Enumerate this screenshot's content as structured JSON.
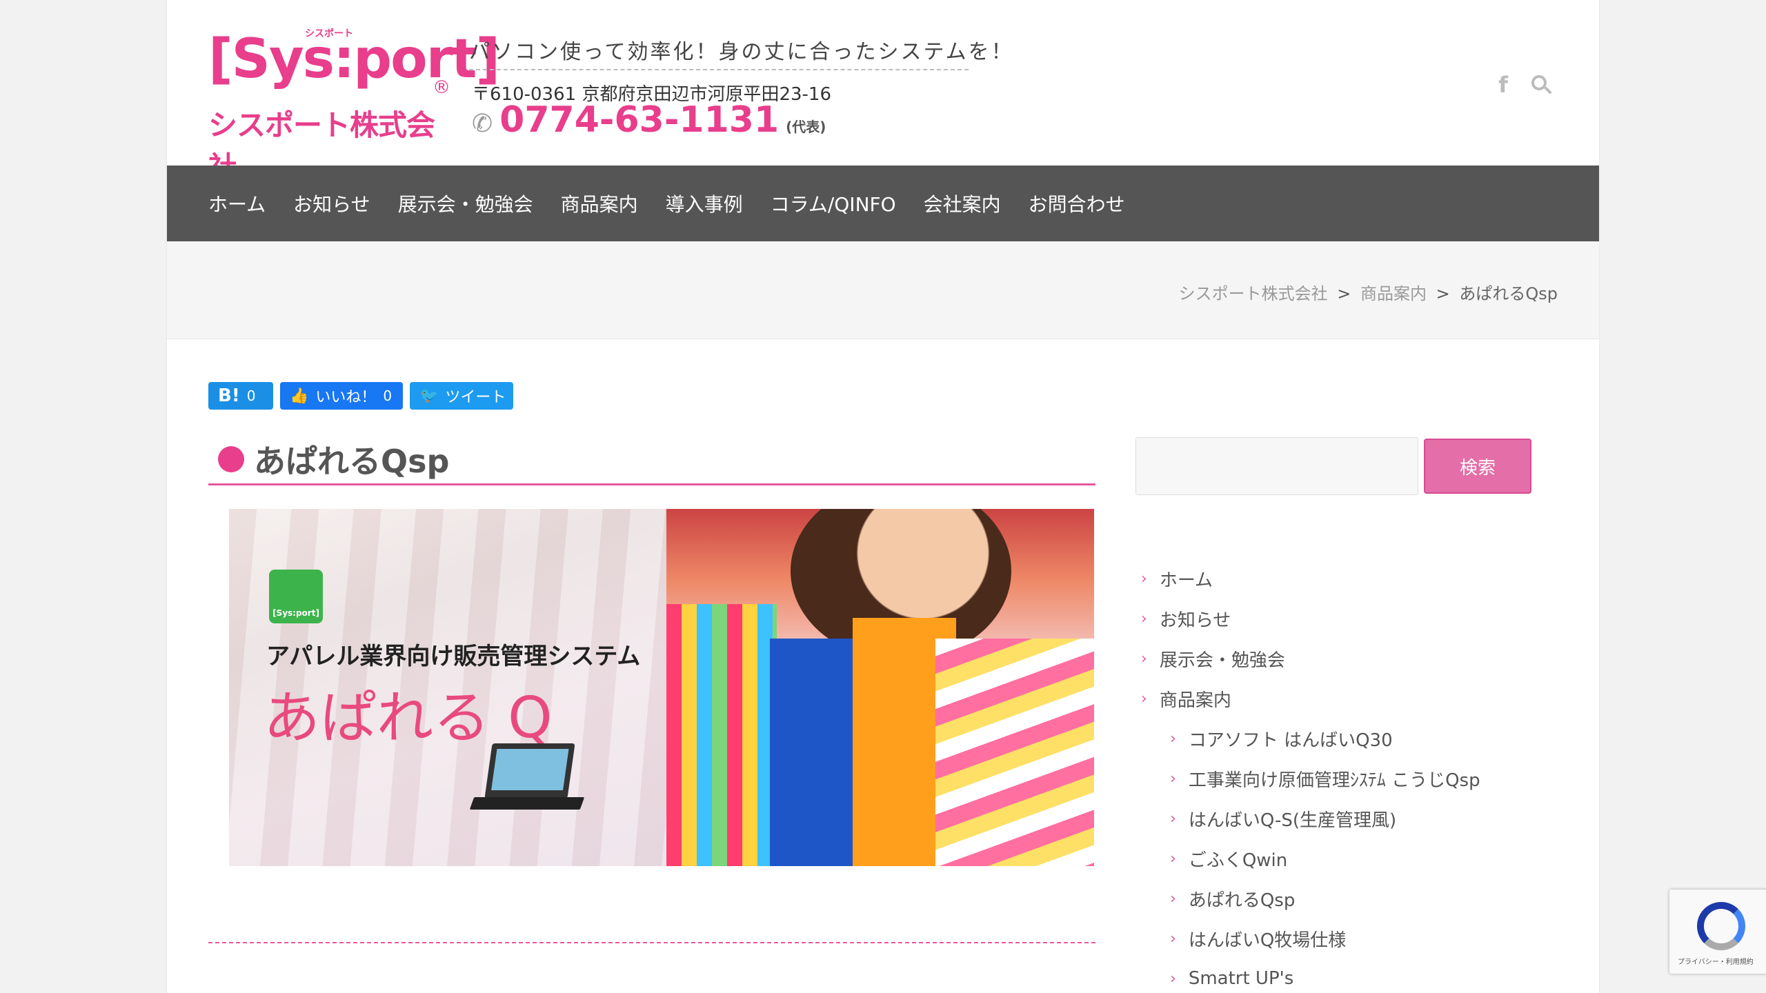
{
  "header": {
    "logo_kana": "シスポート",
    "logo_main": "[Sys:port]",
    "logo_reg": "®",
    "logo_sub": "シスポート株式会社",
    "catch": "パソコン使って効率化！身の丈に合ったシステムを！",
    "address": "〒610-0361 京都府京田辺市河原平田23-16",
    "phone": "0774-63-1131",
    "phone_note": "(代表)",
    "fb_icon": "f"
  },
  "nav": {
    "items": [
      "ホーム",
      "お知らせ",
      "展示会・勉強会",
      "商品案内",
      "導入事例",
      "コラム/QINFO",
      "会社案内",
      "お問合わせ"
    ]
  },
  "breadcrumb": {
    "home": "シスポート株式会社",
    "sep": ">",
    "parent": "商品案内",
    "current": "あぱれるQsp"
  },
  "social": {
    "hatena_label": "B!",
    "hatena_count": "0",
    "fb_label": "いいね！",
    "fb_count": "0",
    "tw_label": "ツイート"
  },
  "article": {
    "title": "あぱれるQsp",
    "hero_badge": "[Sys:port]",
    "hero_subtitle": "アパレル業界向け販売管理システム",
    "hero_title": "あぱれる Q"
  },
  "sidebar": {
    "search_button": "検索",
    "menu": [
      {
        "label": "ホーム",
        "sub": false
      },
      {
        "label": "お知らせ",
        "sub": false
      },
      {
        "label": "展示会・勉強会",
        "sub": false
      },
      {
        "label": "商品案内",
        "sub": false
      },
      {
        "label": "コアソフト はんばいQ30",
        "sub": true
      },
      {
        "label": "工事業向け原価管理ｼｽﾃﾑ こうじQsp",
        "sub": true
      },
      {
        "label": "はんばいQ-S(生産管理風)",
        "sub": true
      },
      {
        "label": "ごふくQwin",
        "sub": true
      },
      {
        "label": "あぱれるQsp",
        "sub": true
      },
      {
        "label": "はんばいQ牧場仕様",
        "sub": true
      },
      {
        "label": "Smatrt UP's",
        "sub": true
      }
    ]
  },
  "recaptcha": {
    "text": "プライバシー・利用規約"
  },
  "colors": {
    "brand_pink": "#e83e8c",
    "nav_bg": "#555555",
    "hatena": "#1b8fe5",
    "facebook": "#1877f2",
    "twitter": "#1d9bf0"
  }
}
